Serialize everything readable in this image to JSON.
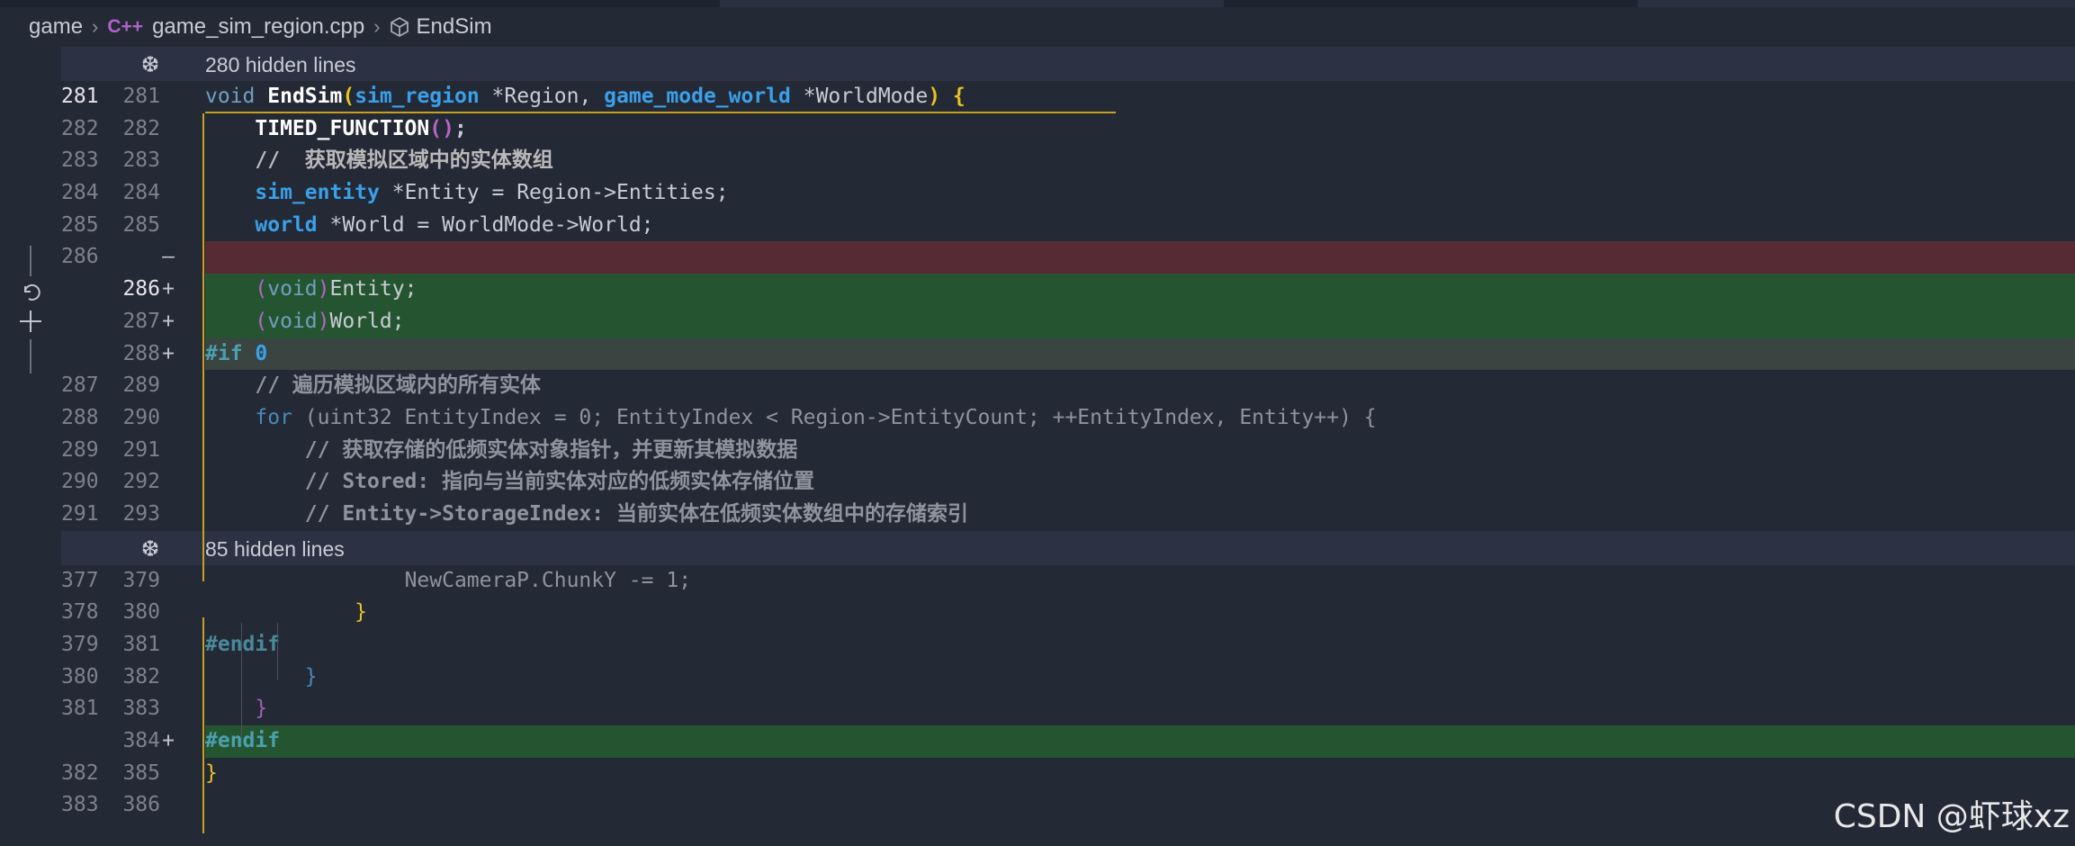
{
  "breadcrumb": {
    "root": "game",
    "file": "game_sim_region.cpp",
    "file_icon": "cpp-icon",
    "symbol": "EndSim",
    "symbol_icon": "cube-icon"
  },
  "folds": [
    {
      "text": "280 hidden lines"
    },
    {
      "text": "85 hidden lines"
    }
  ],
  "lines": [
    {
      "old": "281",
      "new": "281",
      "mark": ""
    },
    {
      "old": "282",
      "new": "282",
      "mark": ""
    },
    {
      "old": "283",
      "new": "283",
      "mark": ""
    },
    {
      "old": "284",
      "new": "284",
      "mark": ""
    },
    {
      "old": "285",
      "new": "285",
      "mark": ""
    },
    {
      "old": "286",
      "new": "",
      "mark": "—"
    },
    {
      "old": "",
      "new": "286",
      "mark": "+"
    },
    {
      "old": "",
      "new": "287",
      "mark": "+"
    },
    {
      "old": "",
      "new": "288",
      "mark": "+"
    },
    {
      "old": "287",
      "new": "289",
      "mark": ""
    },
    {
      "old": "288",
      "new": "290",
      "mark": ""
    },
    {
      "old": "289",
      "new": "291",
      "mark": ""
    },
    {
      "old": "290",
      "new": "292",
      "mark": ""
    },
    {
      "old": "291",
      "new": "293",
      "mark": ""
    },
    {
      "old": "377",
      "new": "379",
      "mark": ""
    },
    {
      "old": "378",
      "new": "380",
      "mark": ""
    },
    {
      "old": "379",
      "new": "381",
      "mark": ""
    },
    {
      "old": "380",
      "new": "382",
      "mark": ""
    },
    {
      "old": "381",
      "new": "383",
      "mark": ""
    },
    {
      "old": "",
      "new": "384",
      "mark": "+"
    },
    {
      "old": "382",
      "new": "385",
      "mark": ""
    },
    {
      "old": "383",
      "new": "386",
      "mark": ""
    }
  ],
  "code": {
    "l281": {
      "void": "void",
      "fn": "EndSim",
      "p1": "(",
      "t1": "sim_region",
      "a1": " *Region, ",
      "t2": "game_mode_world",
      "a2": " *WorldMode",
      "p2": ")",
      "b": " {"
    },
    "l282": {
      "fn": "TIMED_FUNCTION",
      "p": "()",
      "end": ";"
    },
    "l283": {
      "text": "//  获取模拟区域中的实体数组"
    },
    "l284": {
      "t": "sim_entity",
      "rest": " *Entity = Region->Entities;"
    },
    "l285": {
      "t": "world",
      "rest": " *World = WorldMode->World;"
    },
    "l286": {
      "p1": "(",
      "kw": "void",
      "p2": ")",
      "rest": "Entity;"
    },
    "l287": {
      "p1": "(",
      "kw": "void",
      "p2": ")",
      "rest": "World;"
    },
    "l288": {
      "pp": "#if",
      "n": " 0"
    },
    "l289": {
      "text": "// 遍历模拟区域内的所有实体"
    },
    "l290": {
      "kw": "for",
      "rest": " (uint32 EntityIndex = 0; EntityIndex < Region->EntityCount; ++EntityIndex, Entity++) {"
    },
    "l291": {
      "text": "// 获取存储的低频实体对象指针，并更新其模拟数据"
    },
    "l292": {
      "text": "// Stored: 指向与当前实体对应的低频实体存储位置"
    },
    "l293": {
      "text": "// Entity->StorageIndex: 当前实体在低频实体数组中的存储索引"
    },
    "l379": {
      "text": "NewCameraP.ChunkY -= 1;"
    },
    "l380": {
      "text": "}"
    },
    "l381": {
      "text": "#endif"
    },
    "l382": {
      "text": "}"
    },
    "l383": {
      "text": "}"
    },
    "l384": {
      "text": "#endif"
    },
    "l385": {
      "text": "}"
    }
  },
  "left_actions": [
    {
      "icon": "revert-icon"
    },
    {
      "icon": "plus-icon"
    }
  ],
  "watermark": "CSDN @虾球xz",
  "colors": {
    "background": "#242936",
    "deleted_line": "#562b33",
    "added_line": "#255530",
    "keyword": "#3aa0e8",
    "scope_guide": "#c8a020"
  }
}
